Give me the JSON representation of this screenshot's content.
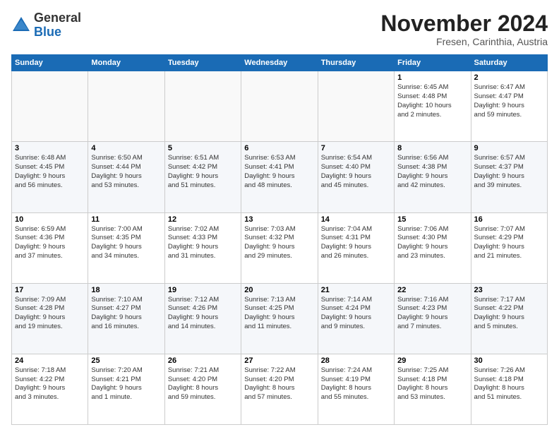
{
  "logo": {
    "general": "General",
    "blue": "Blue"
  },
  "header": {
    "month": "November 2024",
    "location": "Fresen, Carinthia, Austria"
  },
  "days_of_week": [
    "Sunday",
    "Monday",
    "Tuesday",
    "Wednesday",
    "Thursday",
    "Friday",
    "Saturday"
  ],
  "weeks": [
    [
      {
        "day": "",
        "info": ""
      },
      {
        "day": "",
        "info": ""
      },
      {
        "day": "",
        "info": ""
      },
      {
        "day": "",
        "info": ""
      },
      {
        "day": "",
        "info": ""
      },
      {
        "day": "1",
        "info": "Sunrise: 6:45 AM\nSunset: 4:48 PM\nDaylight: 10 hours\nand 2 minutes."
      },
      {
        "day": "2",
        "info": "Sunrise: 6:47 AM\nSunset: 4:47 PM\nDaylight: 9 hours\nand 59 minutes."
      }
    ],
    [
      {
        "day": "3",
        "info": "Sunrise: 6:48 AM\nSunset: 4:45 PM\nDaylight: 9 hours\nand 56 minutes."
      },
      {
        "day": "4",
        "info": "Sunrise: 6:50 AM\nSunset: 4:44 PM\nDaylight: 9 hours\nand 53 minutes."
      },
      {
        "day": "5",
        "info": "Sunrise: 6:51 AM\nSunset: 4:42 PM\nDaylight: 9 hours\nand 51 minutes."
      },
      {
        "day": "6",
        "info": "Sunrise: 6:53 AM\nSunset: 4:41 PM\nDaylight: 9 hours\nand 48 minutes."
      },
      {
        "day": "7",
        "info": "Sunrise: 6:54 AM\nSunset: 4:40 PM\nDaylight: 9 hours\nand 45 minutes."
      },
      {
        "day": "8",
        "info": "Sunrise: 6:56 AM\nSunset: 4:38 PM\nDaylight: 9 hours\nand 42 minutes."
      },
      {
        "day": "9",
        "info": "Sunrise: 6:57 AM\nSunset: 4:37 PM\nDaylight: 9 hours\nand 39 minutes."
      }
    ],
    [
      {
        "day": "10",
        "info": "Sunrise: 6:59 AM\nSunset: 4:36 PM\nDaylight: 9 hours\nand 37 minutes."
      },
      {
        "day": "11",
        "info": "Sunrise: 7:00 AM\nSunset: 4:35 PM\nDaylight: 9 hours\nand 34 minutes."
      },
      {
        "day": "12",
        "info": "Sunrise: 7:02 AM\nSunset: 4:33 PM\nDaylight: 9 hours\nand 31 minutes."
      },
      {
        "day": "13",
        "info": "Sunrise: 7:03 AM\nSunset: 4:32 PM\nDaylight: 9 hours\nand 29 minutes."
      },
      {
        "day": "14",
        "info": "Sunrise: 7:04 AM\nSunset: 4:31 PM\nDaylight: 9 hours\nand 26 minutes."
      },
      {
        "day": "15",
        "info": "Sunrise: 7:06 AM\nSunset: 4:30 PM\nDaylight: 9 hours\nand 23 minutes."
      },
      {
        "day": "16",
        "info": "Sunrise: 7:07 AM\nSunset: 4:29 PM\nDaylight: 9 hours\nand 21 minutes."
      }
    ],
    [
      {
        "day": "17",
        "info": "Sunrise: 7:09 AM\nSunset: 4:28 PM\nDaylight: 9 hours\nand 19 minutes."
      },
      {
        "day": "18",
        "info": "Sunrise: 7:10 AM\nSunset: 4:27 PM\nDaylight: 9 hours\nand 16 minutes."
      },
      {
        "day": "19",
        "info": "Sunrise: 7:12 AM\nSunset: 4:26 PM\nDaylight: 9 hours\nand 14 minutes."
      },
      {
        "day": "20",
        "info": "Sunrise: 7:13 AM\nSunset: 4:25 PM\nDaylight: 9 hours\nand 11 minutes."
      },
      {
        "day": "21",
        "info": "Sunrise: 7:14 AM\nSunset: 4:24 PM\nDaylight: 9 hours\nand 9 minutes."
      },
      {
        "day": "22",
        "info": "Sunrise: 7:16 AM\nSunset: 4:23 PM\nDaylight: 9 hours\nand 7 minutes."
      },
      {
        "day": "23",
        "info": "Sunrise: 7:17 AM\nSunset: 4:22 PM\nDaylight: 9 hours\nand 5 minutes."
      }
    ],
    [
      {
        "day": "24",
        "info": "Sunrise: 7:18 AM\nSunset: 4:22 PM\nDaylight: 9 hours\nand 3 minutes."
      },
      {
        "day": "25",
        "info": "Sunrise: 7:20 AM\nSunset: 4:21 PM\nDaylight: 9 hours\nand 1 minute."
      },
      {
        "day": "26",
        "info": "Sunrise: 7:21 AM\nSunset: 4:20 PM\nDaylight: 8 hours\nand 59 minutes."
      },
      {
        "day": "27",
        "info": "Sunrise: 7:22 AM\nSunset: 4:20 PM\nDaylight: 8 hours\nand 57 minutes."
      },
      {
        "day": "28",
        "info": "Sunrise: 7:24 AM\nSunset: 4:19 PM\nDaylight: 8 hours\nand 55 minutes."
      },
      {
        "day": "29",
        "info": "Sunrise: 7:25 AM\nSunset: 4:18 PM\nDaylight: 8 hours\nand 53 minutes."
      },
      {
        "day": "30",
        "info": "Sunrise: 7:26 AM\nSunset: 4:18 PM\nDaylight: 8 hours\nand 51 minutes."
      }
    ]
  ]
}
